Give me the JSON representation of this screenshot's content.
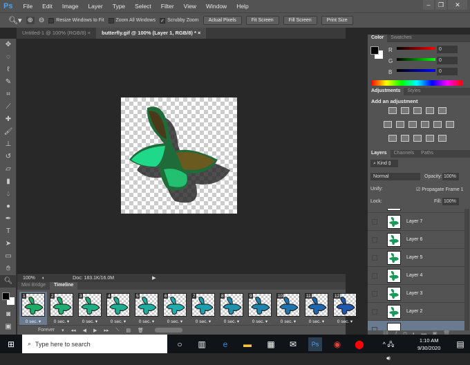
{
  "app": {
    "logo": "Ps"
  },
  "menu": [
    "File",
    "Edit",
    "Image",
    "Layer",
    "Type",
    "Select",
    "Filter",
    "View",
    "Window",
    "Help"
  ],
  "options": {
    "resize_windows": "Resize Windows to Fit",
    "zoom_all": "Zoom All Windows",
    "scrubby": "Scrubby Zoom",
    "actual_pixels": "Actual Pixels",
    "fit_screen": "Fit Screen",
    "fill_screen": "Fill Screen",
    "print_size": "Print Size"
  },
  "doc_tabs": [
    {
      "label": "Untitled-1 @ 100% (RGB/8)"
    },
    {
      "label": "butterfly.gif @ 100% (Layer 1, RGB/8) *"
    }
  ],
  "status": {
    "zoom": "100%",
    "doc": "Doc: 183.1K/16.0M"
  },
  "bottom_tabs": [
    "Mini Bridge",
    "Timeline"
  ],
  "timeline": {
    "frames": [
      {
        "n": "1",
        "d": "0 sec."
      },
      {
        "n": "2",
        "d": "0 sec."
      },
      {
        "n": "3",
        "d": "0 sec."
      },
      {
        "n": "4",
        "d": "0 sec."
      },
      {
        "n": "5",
        "d": "0 sec."
      },
      {
        "n": "6",
        "d": "0 sec."
      },
      {
        "n": "7",
        "d": "0 sec."
      },
      {
        "n": "8",
        "d": "0 sec."
      },
      {
        "n": "9",
        "d": "0 sec."
      },
      {
        "n": "10",
        "d": "0 sec."
      },
      {
        "n": "11",
        "d": "0 sec."
      },
      {
        "n": "12",
        "d": "0 sec."
      }
    ],
    "loop": "Forever"
  },
  "color_panel": {
    "tabs": [
      "Color",
      "Swatches"
    ],
    "r_label": "R",
    "g_label": "G",
    "b_label": "B",
    "r": "0",
    "g": "0",
    "b": "0"
  },
  "adjustments": {
    "tabs": [
      "Adjustments",
      "Styles"
    ],
    "title": "Add an adjustment"
  },
  "layers": {
    "tabs": [
      "Layers",
      "Channels",
      "Paths"
    ],
    "filter": "Kind",
    "blend": "Normal",
    "opacity_label": "Opacity:",
    "opacity": "100%",
    "unify": "Unify:",
    "propagate": "Propagate Frame 1",
    "lock": "Lock:",
    "fill_label": "Fill:",
    "fill": "100%",
    "items": [
      "Layer 7",
      "Layer 6",
      "Layer 5",
      "Layer 4",
      "Layer 3",
      "Layer 2"
    ]
  },
  "taskbar": {
    "search": "Type here to search",
    "time": "1:10 AM",
    "date": "9/30/2020"
  }
}
